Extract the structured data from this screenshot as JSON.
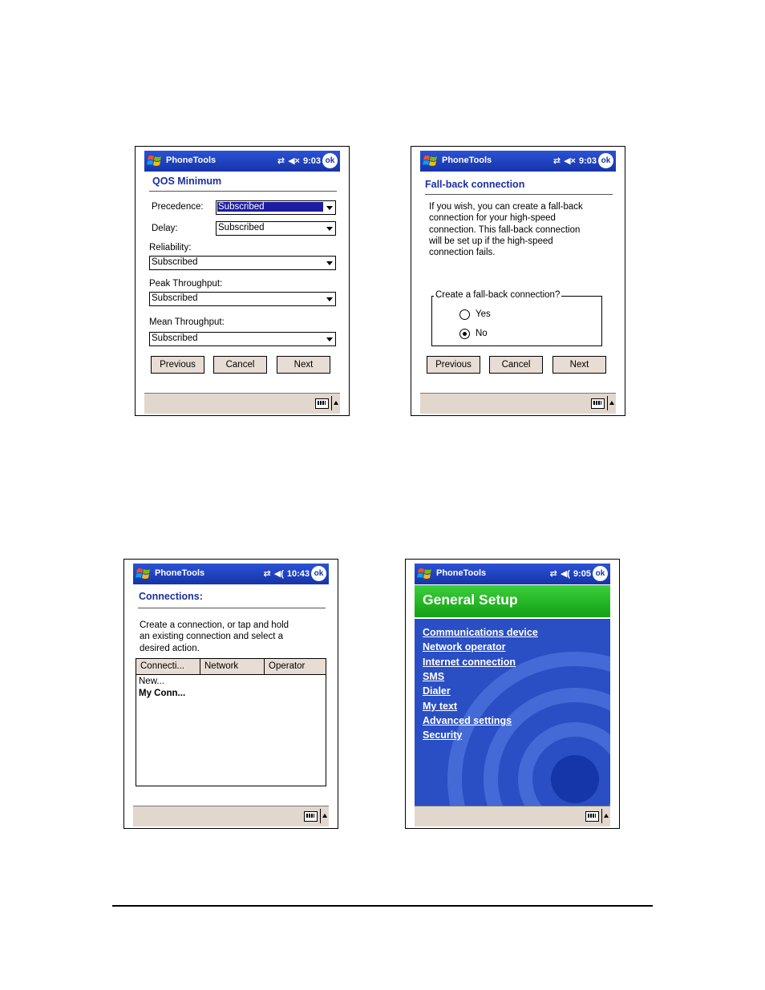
{
  "common": {
    "app_title": "PhoneTools",
    "ok_label": "ok",
    "icons": [
      "windows-flag-icon",
      "connectivity-icon",
      "speaker-muted-icon",
      "ok-icon",
      "keyboard-icon",
      "up-arrow-icon"
    ]
  },
  "screen1": {
    "time": "9:03",
    "heading": "QOS Minimum",
    "precedence_label": "Precedence:",
    "precedence_value": "Subscribed",
    "delay_label": "Delay:",
    "delay_value": "Subscribed",
    "reliability_label": "Reliability:",
    "reliability_value": "Subscribed",
    "peak_label": "Peak Throughput:",
    "peak_value": "Subscribed",
    "mean_label": "Mean Throughput:",
    "mean_value": "Subscribed",
    "previous": "Previous",
    "cancel": "Cancel",
    "next": "Next"
  },
  "screen2": {
    "time": "9:03",
    "heading": "Fall-back connection",
    "description": [
      "If you wish, you can create a fall-back",
      "connection for your high-speed",
      "connection. This fall-back connection",
      "will be set up if the high-speed",
      "connection fails."
    ],
    "group_label": "Create a fall-back connection?",
    "yes": "Yes",
    "no": "No",
    "selected": "No",
    "previous": "Previous",
    "cancel": "Cancel",
    "next": "Next"
  },
  "screen3": {
    "time": "10:43",
    "heading": "Connections:",
    "description": [
      "Create a connection, or tap and hold",
      "an existing connection and select a",
      "desired action."
    ],
    "columns": [
      "Connecti...",
      "Network",
      "Operator"
    ],
    "rows": [
      "New...",
      "My Conn..."
    ]
  },
  "screen4": {
    "time": "9:05",
    "heading": "General Setup",
    "links": [
      "Communications device",
      "Network operator",
      "Internet connection",
      "SMS",
      "Dialer",
      "My text",
      "Advanced settings",
      "Security"
    ]
  }
}
